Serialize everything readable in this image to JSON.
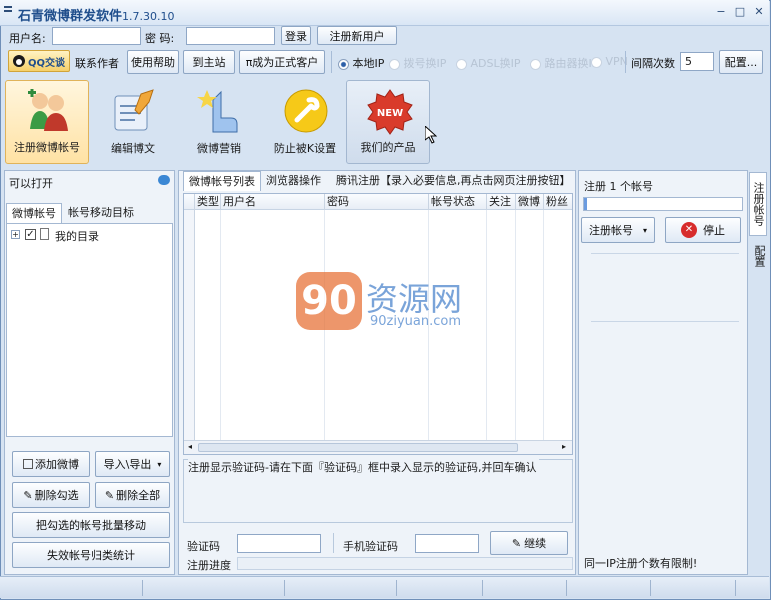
{
  "title": {
    "name": "石青微博群发软件",
    "version": "1.7.30.10"
  },
  "login": {
    "username_label": "用户名:",
    "password_label": "密  码:",
    "login_button": "登录",
    "register_button": "注册新用户"
  },
  "toolbar": {
    "qq_button": "QQ交谈",
    "contact_author": "联系作者",
    "help": "使用帮助",
    "home": "到主站",
    "become_customer": "π成为正式客户",
    "ip_options": [
      "本地IP",
      "拨号换IP",
      "ADSL换IP",
      "路由器换IP",
      "VPN"
    ],
    "interval_label": "间隔次数",
    "interval_value": "5",
    "config_button": "配置..."
  },
  "bigbar": {
    "items": [
      {
        "label": "注册微博帐号",
        "icon": "user-register-icon"
      },
      {
        "label": "编辑博文",
        "icon": "edit-post-icon"
      },
      {
        "label": "微博营销",
        "icon": "marketing-icon"
      },
      {
        "label": "防止被K设置",
        "icon": "wrench-icon"
      },
      {
        "label": "我们的产品",
        "icon": "new-badge-icon"
      }
    ]
  },
  "left": {
    "header": "可以打开",
    "tabs": [
      "微博帐号",
      "帐号移动目标"
    ],
    "tree_root": "我的目录",
    "buttons": {
      "add": "添加微博",
      "import_export": "导入\\导出",
      "delete_checked": "删除勾选",
      "delete_all": "删除全部",
      "batch_move": "把勾选的帐号批量移动",
      "invalid_stats": "失效帐号归类统计"
    }
  },
  "center": {
    "tabs": [
      "微博帐号列表",
      "浏览器操作",
      "腾讯注册【录入必要信息,再点击网页注册按钮】"
    ],
    "columns": [
      "类型",
      "用户名",
      "密码",
      "帐号状态",
      "关注",
      "微博",
      "粉丝"
    ],
    "watermark_main": "资源网",
    "watermark_num": "90",
    "watermark_url": "90ziyuan.com",
    "captcha_group": "注册显示验证码-请在下面『验证码』框中录入显示的验证码,并回车确认",
    "captcha_label": "验证码",
    "phone_captcha_label": "手机验证码",
    "continue_button": "继续",
    "progress_label": "注册进度"
  },
  "right": {
    "title": "注册 1 个帐号",
    "progress": 0.02,
    "register_button": "注册帐号",
    "stop_button": "停止",
    "limit_note": "同一IP注册个数有限制!",
    "side_tabs": [
      "注册帐号",
      "配置"
    ]
  },
  "colors": {
    "accent": "#1f4e8c",
    "selected": "#ffe2a4",
    "stop_red": "#d72c2c"
  }
}
